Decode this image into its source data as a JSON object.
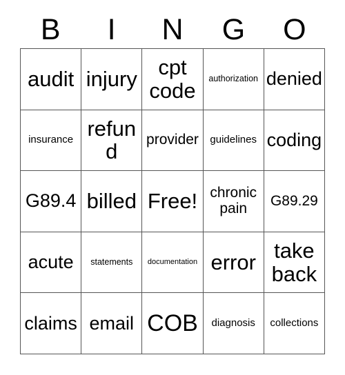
{
  "card": {
    "title": "BINGO",
    "free_space_label": "Free!",
    "border_color": "#555555",
    "background_color": "#ffffff",
    "text_color": "#000000"
  },
  "header": {
    "letters": [
      "B",
      "I",
      "N",
      "G",
      "O"
    ]
  },
  "grid": {
    "rows": 5,
    "columns": 5,
    "cells": [
      [
        {
          "text": "audit",
          "size": "sz-lg"
        },
        {
          "text": "injury",
          "size": "sz-lg"
        },
        {
          "text": "cpt code",
          "size": "sz-lg"
        },
        {
          "text": "authorization",
          "size": "sz-xxs"
        },
        {
          "text": "denied",
          "size": "sz-md"
        }
      ],
      [
        {
          "text": "insurance",
          "size": "sz-xs"
        },
        {
          "text": "refund",
          "size": "sz-lg"
        },
        {
          "text": "provider",
          "size": "sz-sm"
        },
        {
          "text": "guidelines",
          "size": "sz-xs"
        },
        {
          "text": "coding",
          "size": "sz-md"
        }
      ],
      [
        {
          "text": "G89.4",
          "size": "sz-md"
        },
        {
          "text": "billed",
          "size": "sz-lg"
        },
        {
          "text": "Free!",
          "size": "sz-lg"
        },
        {
          "text": "chronic pain",
          "size": "sz-sm"
        },
        {
          "text": "G89.29",
          "size": "sz-sm"
        }
      ],
      [
        {
          "text": "acute",
          "size": "sz-md"
        },
        {
          "text": "statements",
          "size": "sz-xxs"
        },
        {
          "text": "documentation",
          "size": "sz-tiny"
        },
        {
          "text": "error",
          "size": "sz-lg"
        },
        {
          "text": "take back",
          "size": "sz-lg"
        }
      ],
      [
        {
          "text": "claims",
          "size": "sz-md"
        },
        {
          "text": "email",
          "size": "sz-md"
        },
        {
          "text": "COB",
          "size": "sz-xl"
        },
        {
          "text": "diagnosis",
          "size": "sz-xs"
        },
        {
          "text": "collections",
          "size": "sz-xs"
        }
      ]
    ]
  }
}
